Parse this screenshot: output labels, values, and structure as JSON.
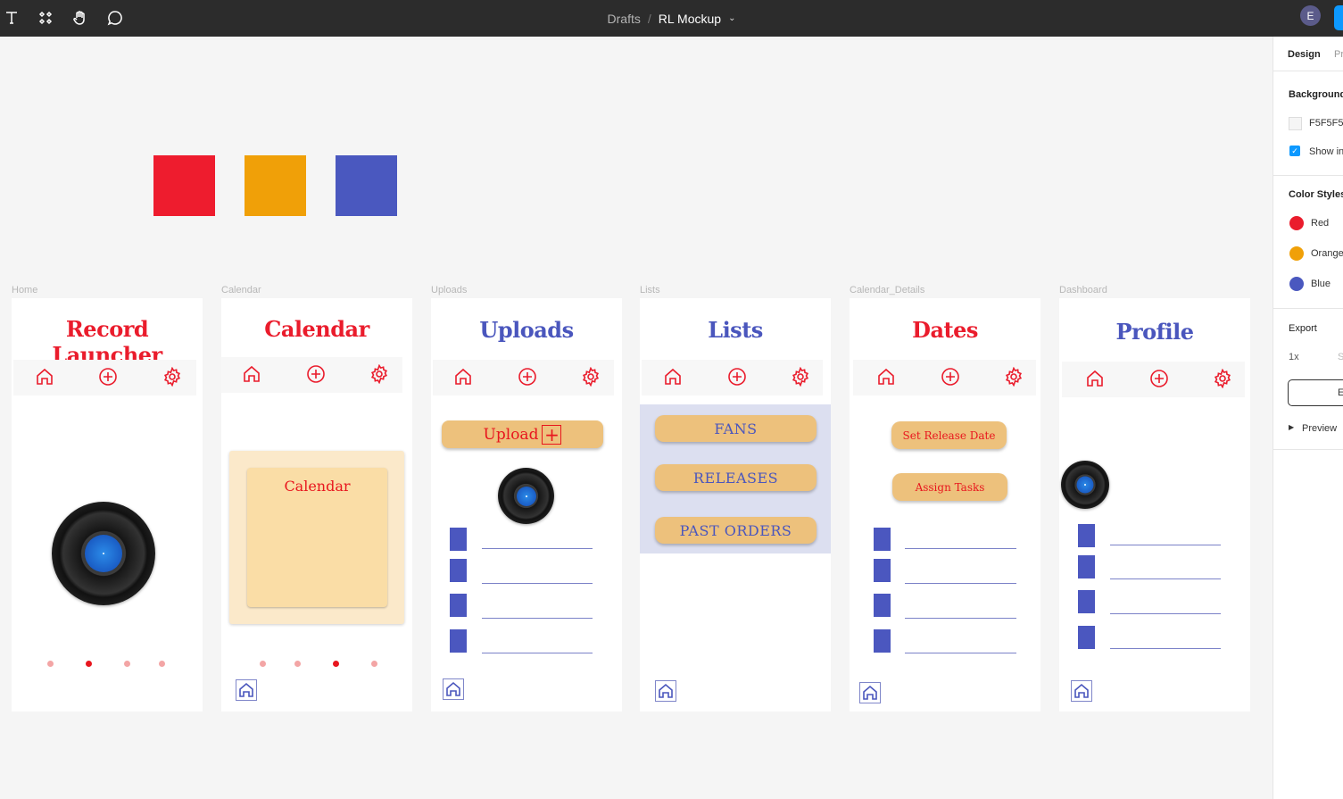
{
  "topbar": {
    "breadcrumb": {
      "project": "Drafts",
      "separator": "/",
      "file": "RL Mockup"
    },
    "avatar_initial": "E",
    "tools": [
      "text-tool-icon",
      "components-icon",
      "hand-tool-icon",
      "comment-icon"
    ]
  },
  "canvas": {
    "swatches": [
      {
        "name": "red",
        "color": "#ee1c2e"
      },
      {
        "name": "orange",
        "color": "#f0a008"
      },
      {
        "name": "blue",
        "color": "#4a58bf"
      }
    ],
    "frames": [
      {
        "label": "Home",
        "title": "Record Launcher",
        "title_color": "#ea1c2c"
      },
      {
        "label": "Calendar",
        "title": "Calendar",
        "title_color": "#ea1c2c",
        "card_text": "Calendar"
      },
      {
        "label": "Uploads",
        "title": "Uploads",
        "title_color": "#4a56bd",
        "upload_label": "Upload"
      },
      {
        "label": "Lists",
        "title": "Lists",
        "title_color": "#4a56bd",
        "buttons": [
          "FANS",
          "RELEASES",
          "PAST ORDERS"
        ]
      },
      {
        "label": "Calendar_Details",
        "title": "Dates",
        "title_color": "#ea1c2c",
        "buttons": [
          "Set Release Date",
          "Assign Tasks"
        ]
      },
      {
        "label": "Dashboard",
        "title": "Profile",
        "title_color": "#4a56bd"
      }
    ],
    "pagination": {
      "home_active_index": 1,
      "calendar_active_index": 2,
      "count": 4
    }
  },
  "panel": {
    "tabs": [
      "Design",
      "Pr"
    ],
    "background": {
      "heading": "Background",
      "value": "F5F5F5",
      "show_in_exports": "Show in",
      "checked": true
    },
    "color_styles": {
      "heading": "Color Styles",
      "items": [
        {
          "name": "Red",
          "color": "#ea1c2c"
        },
        {
          "name": "Orange",
          "color": "#f0a008"
        },
        {
          "name": "Blue",
          "color": "#4a58bf"
        }
      ]
    },
    "export": {
      "heading": "Export",
      "scale": "1x",
      "suffix": "S",
      "button": "E",
      "preview": "Preview"
    }
  }
}
